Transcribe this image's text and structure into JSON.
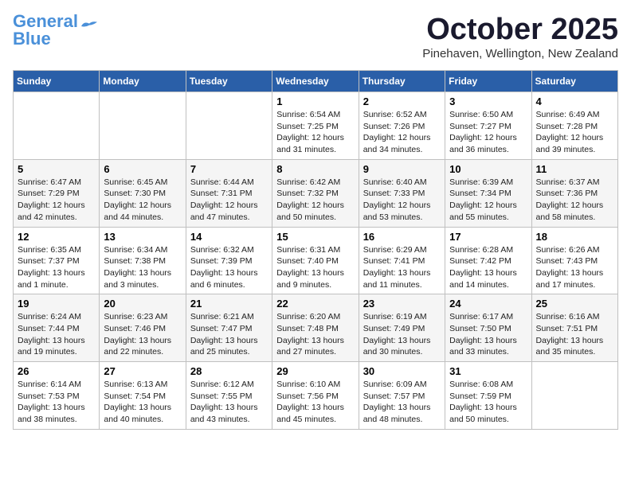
{
  "header": {
    "logo_line1": "General",
    "logo_line2": "Blue",
    "month": "October 2025",
    "location": "Pinehaven, Wellington, New Zealand"
  },
  "days_of_week": [
    "Sunday",
    "Monday",
    "Tuesday",
    "Wednesday",
    "Thursday",
    "Friday",
    "Saturday"
  ],
  "weeks": [
    [
      {
        "day": "",
        "info": ""
      },
      {
        "day": "",
        "info": ""
      },
      {
        "day": "",
        "info": ""
      },
      {
        "day": "1",
        "info": "Sunrise: 6:54 AM\nSunset: 7:25 PM\nDaylight: 12 hours\nand 31 minutes."
      },
      {
        "day": "2",
        "info": "Sunrise: 6:52 AM\nSunset: 7:26 PM\nDaylight: 12 hours\nand 34 minutes."
      },
      {
        "day": "3",
        "info": "Sunrise: 6:50 AM\nSunset: 7:27 PM\nDaylight: 12 hours\nand 36 minutes."
      },
      {
        "day": "4",
        "info": "Sunrise: 6:49 AM\nSunset: 7:28 PM\nDaylight: 12 hours\nand 39 minutes."
      }
    ],
    [
      {
        "day": "5",
        "info": "Sunrise: 6:47 AM\nSunset: 7:29 PM\nDaylight: 12 hours\nand 42 minutes."
      },
      {
        "day": "6",
        "info": "Sunrise: 6:45 AM\nSunset: 7:30 PM\nDaylight: 12 hours\nand 44 minutes."
      },
      {
        "day": "7",
        "info": "Sunrise: 6:44 AM\nSunset: 7:31 PM\nDaylight: 12 hours\nand 47 minutes."
      },
      {
        "day": "8",
        "info": "Sunrise: 6:42 AM\nSunset: 7:32 PM\nDaylight: 12 hours\nand 50 minutes."
      },
      {
        "day": "9",
        "info": "Sunrise: 6:40 AM\nSunset: 7:33 PM\nDaylight: 12 hours\nand 53 minutes."
      },
      {
        "day": "10",
        "info": "Sunrise: 6:39 AM\nSunset: 7:34 PM\nDaylight: 12 hours\nand 55 minutes."
      },
      {
        "day": "11",
        "info": "Sunrise: 6:37 AM\nSunset: 7:36 PM\nDaylight: 12 hours\nand 58 minutes."
      }
    ],
    [
      {
        "day": "12",
        "info": "Sunrise: 6:35 AM\nSunset: 7:37 PM\nDaylight: 13 hours\nand 1 minute."
      },
      {
        "day": "13",
        "info": "Sunrise: 6:34 AM\nSunset: 7:38 PM\nDaylight: 13 hours\nand 3 minutes."
      },
      {
        "day": "14",
        "info": "Sunrise: 6:32 AM\nSunset: 7:39 PM\nDaylight: 13 hours\nand 6 minutes."
      },
      {
        "day": "15",
        "info": "Sunrise: 6:31 AM\nSunset: 7:40 PM\nDaylight: 13 hours\nand 9 minutes."
      },
      {
        "day": "16",
        "info": "Sunrise: 6:29 AM\nSunset: 7:41 PM\nDaylight: 13 hours\nand 11 minutes."
      },
      {
        "day": "17",
        "info": "Sunrise: 6:28 AM\nSunset: 7:42 PM\nDaylight: 13 hours\nand 14 minutes."
      },
      {
        "day": "18",
        "info": "Sunrise: 6:26 AM\nSunset: 7:43 PM\nDaylight: 13 hours\nand 17 minutes."
      }
    ],
    [
      {
        "day": "19",
        "info": "Sunrise: 6:24 AM\nSunset: 7:44 PM\nDaylight: 13 hours\nand 19 minutes."
      },
      {
        "day": "20",
        "info": "Sunrise: 6:23 AM\nSunset: 7:46 PM\nDaylight: 13 hours\nand 22 minutes."
      },
      {
        "day": "21",
        "info": "Sunrise: 6:21 AM\nSunset: 7:47 PM\nDaylight: 13 hours\nand 25 minutes."
      },
      {
        "day": "22",
        "info": "Sunrise: 6:20 AM\nSunset: 7:48 PM\nDaylight: 13 hours\nand 27 minutes."
      },
      {
        "day": "23",
        "info": "Sunrise: 6:19 AM\nSunset: 7:49 PM\nDaylight: 13 hours\nand 30 minutes."
      },
      {
        "day": "24",
        "info": "Sunrise: 6:17 AM\nSunset: 7:50 PM\nDaylight: 13 hours\nand 33 minutes."
      },
      {
        "day": "25",
        "info": "Sunrise: 6:16 AM\nSunset: 7:51 PM\nDaylight: 13 hours\nand 35 minutes."
      }
    ],
    [
      {
        "day": "26",
        "info": "Sunrise: 6:14 AM\nSunset: 7:53 PM\nDaylight: 13 hours\nand 38 minutes."
      },
      {
        "day": "27",
        "info": "Sunrise: 6:13 AM\nSunset: 7:54 PM\nDaylight: 13 hours\nand 40 minutes."
      },
      {
        "day": "28",
        "info": "Sunrise: 6:12 AM\nSunset: 7:55 PM\nDaylight: 13 hours\nand 43 minutes."
      },
      {
        "day": "29",
        "info": "Sunrise: 6:10 AM\nSunset: 7:56 PM\nDaylight: 13 hours\nand 45 minutes."
      },
      {
        "day": "30",
        "info": "Sunrise: 6:09 AM\nSunset: 7:57 PM\nDaylight: 13 hours\nand 48 minutes."
      },
      {
        "day": "31",
        "info": "Sunrise: 6:08 AM\nSunset: 7:59 PM\nDaylight: 13 hours\nand 50 minutes."
      },
      {
        "day": "",
        "info": ""
      }
    ]
  ]
}
